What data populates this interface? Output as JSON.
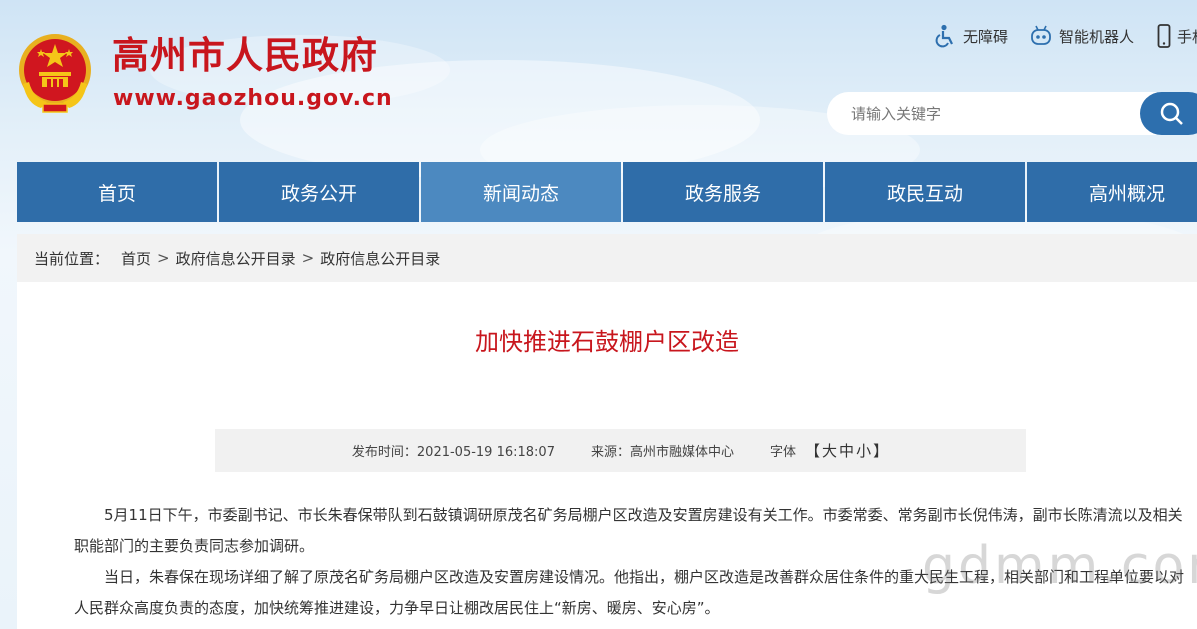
{
  "header": {
    "site_title": "高州市人民政府",
    "site_url": "www.gaozhou.gov.cn",
    "tools": {
      "accessibility": "无障碍",
      "robot": "智能机器人",
      "mobile": "手机"
    },
    "search_placeholder": "请输入关键字"
  },
  "nav": {
    "items": [
      {
        "label": "首页"
      },
      {
        "label": "政务公开"
      },
      {
        "label": "新闻动态"
      },
      {
        "label": "政务服务"
      },
      {
        "label": "政民互动"
      },
      {
        "label": "高州概况"
      }
    ],
    "active_index": 2
  },
  "breadcrumb": {
    "lead": "当前位置：",
    "items": [
      "首页",
      "政府信息公开目录",
      "政府信息公开目录"
    ],
    "separator": ">"
  },
  "article": {
    "title": "加快推进石鼓棚户区改造",
    "meta": {
      "published": "发布时间：2021-05-19 16:18:07",
      "source": "来源：高州市融媒体中心",
      "font_label": "字体",
      "font_open": "【",
      "font_large": "大",
      "font_medium": "中",
      "font_small": "小",
      "font_close": "】"
    },
    "paragraphs": [
      "5月11日下午，市委副书记、市长朱春保带队到石鼓镇调研原茂名矿务局棚户区改造及安置房建设有关工作。市委常委、常务副市长倪伟涛，副市长陈清流以及相关职能部门的主要负责同志参加调研。",
      "当日，朱春保在现场详细了解了原茂名矿务局棚户区改造及安置房建设情况。他指出，棚户区改造是改善群众居住条件的重大民生工程，相关部门和工程单位要以对人民群众高度负责的态度，加快统筹推进建设，力争早日让棚改居民住上“新房、暖房、安心房”。"
    ]
  },
  "watermark": "gdmm.com",
  "colors": {
    "brand_red": "#c8161d",
    "nav_blue": "#2f6da9",
    "nav_active": "#4c89c0"
  }
}
